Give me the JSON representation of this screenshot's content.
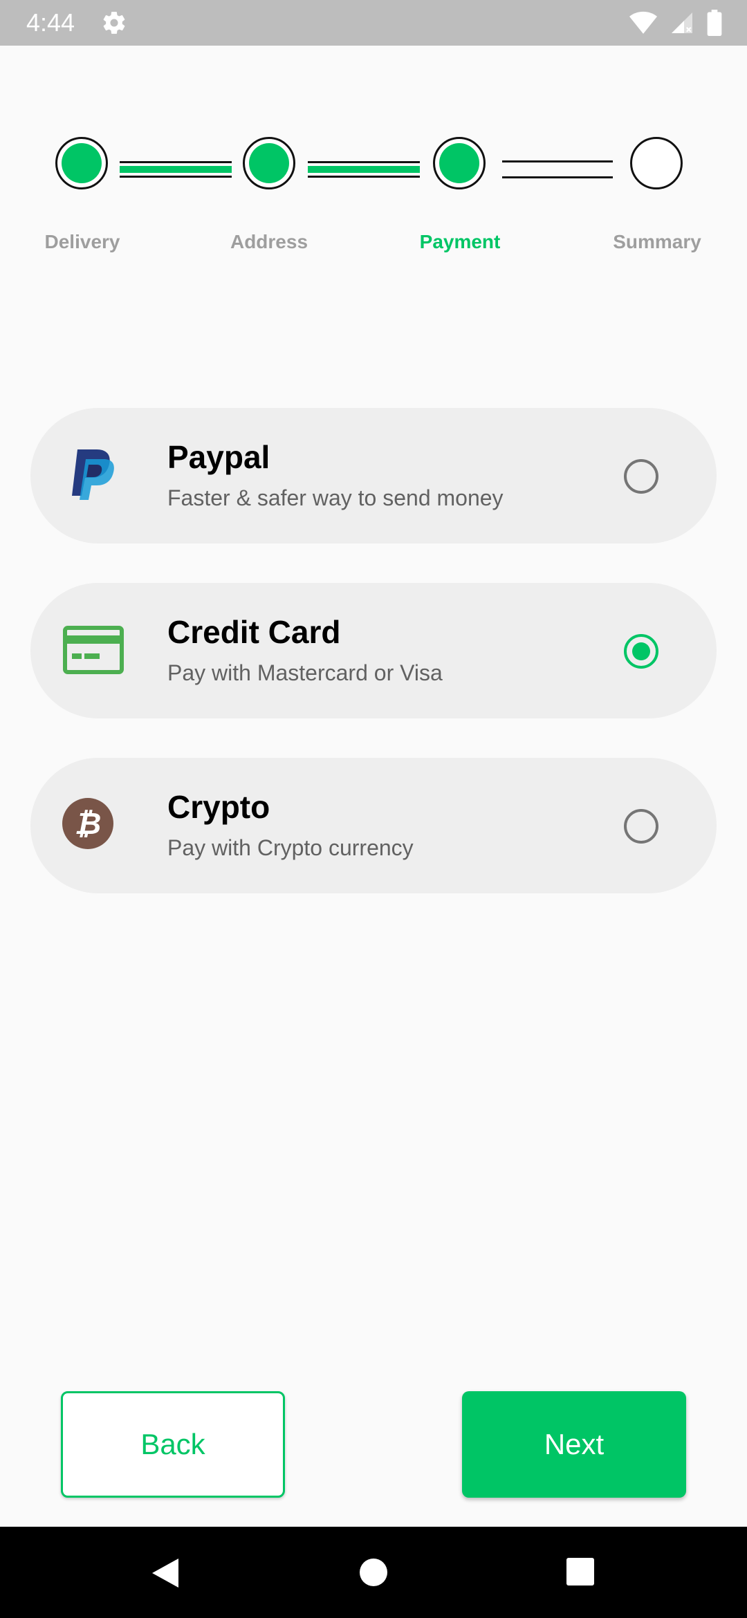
{
  "status_bar": {
    "time": "4:44",
    "icons": [
      "settings-icon",
      "wifi-icon",
      "signal-icon",
      "battery-icon"
    ]
  },
  "stepper": {
    "steps": [
      {
        "label": "Delivery",
        "state": "done"
      },
      {
        "label": "Address",
        "state": "done"
      },
      {
        "label": "Payment",
        "state": "active"
      },
      {
        "label": "Summary",
        "state": "todo"
      }
    ]
  },
  "payment_options": [
    {
      "title": "Paypal",
      "subtitle": "Faster & safer way to send money",
      "icon": "paypal-icon",
      "selected": false
    },
    {
      "title": "Credit Card",
      "subtitle": "Pay with Mastercard or Visa",
      "icon": "credit-card-icon",
      "selected": true
    },
    {
      "title": "Crypto",
      "subtitle": "Pay with Crypto currency",
      "icon": "bitcoin-icon",
      "selected": false
    }
  ],
  "actions": {
    "back_label": "Back",
    "next_label": "Next"
  },
  "colors": {
    "accent": "#00c565",
    "card_bg": "#eeeeee",
    "page_bg": "#fafafa",
    "status_bar": "#bdbdbd"
  }
}
